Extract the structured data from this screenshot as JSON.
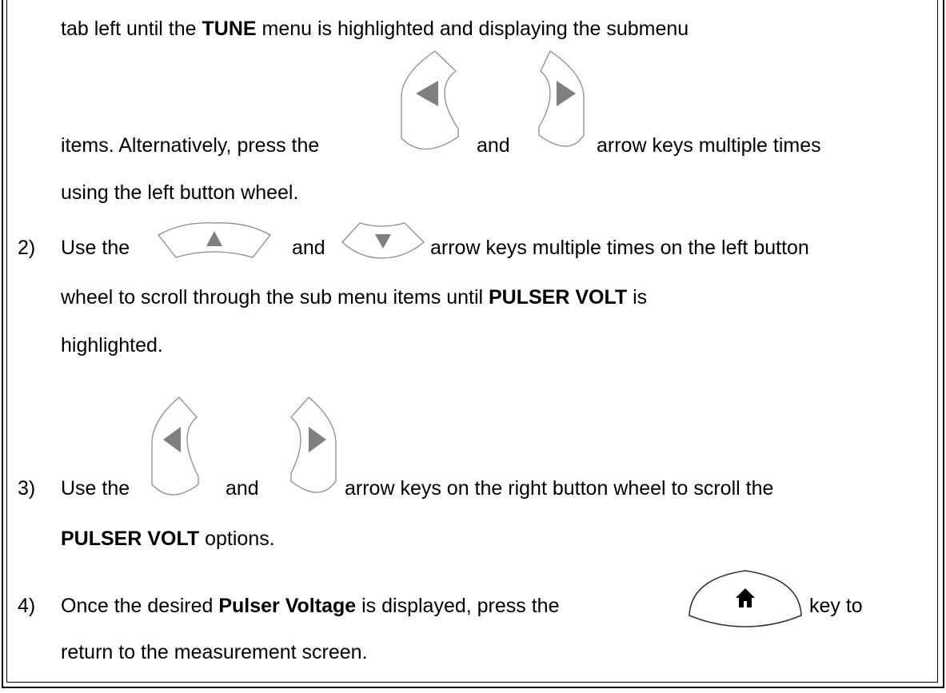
{
  "step1": {
    "line1_pre": "tab left until the ",
    "line1_bold": "TUNE",
    "line1_post": " menu is highlighted and displaying the submenu",
    "line2_a": "items.  Alternatively, press the ",
    "line2_and": "and",
    "line2_b": "arrow keys multiple times",
    "line3": "using the left button wheel."
  },
  "step2": {
    "number": "2)",
    "line1_a": "Use the",
    "line1_and": "and",
    "line1_b": "arrow keys multiple times on the left button",
    "line2_pre": "wheel to scroll through the sub menu items until ",
    "line2_bold": "PULSER VOLT",
    "line2_post": " is",
    "line3": "highlighted."
  },
  "step3": {
    "number": "3)",
    "line1_a": "Use the",
    "line1_and": "and",
    "line1_b": "arrow keys on the right button wheel to scroll the",
    "line2_bold": "PULSER VOLT",
    "line2_post": " options."
  },
  "step4": {
    "number": "4)",
    "line1_pre": "Once the desired ",
    "line1_bold": "Pulser Voltage",
    "line1_post": " is displayed, press the",
    "line1_end": "key to",
    "line2": "return to the measurement screen."
  },
  "icons": {
    "left_arrow": "left-arrow-key",
    "right_arrow": "right-arrow-key",
    "up_arrow": "up-arrow-key",
    "down_arrow": "down-arrow-key",
    "home": "home-key"
  },
  "colors": {
    "key_outline": "#8c8c8c",
    "arrow_fill": "#7f7f7f"
  }
}
